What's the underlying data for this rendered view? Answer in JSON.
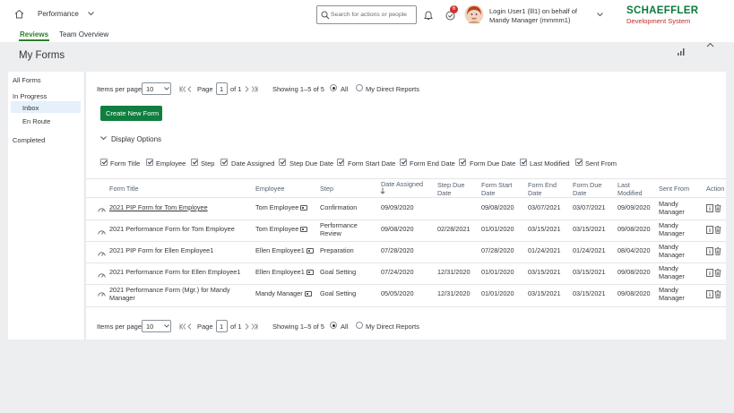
{
  "shell": {
    "module": "Performance",
    "search_placeholder": "Search for actions or people",
    "notif_count": "6",
    "login_line1": "Login User1 (lll1) on behalf of",
    "login_line2": "Mandy Manager (mmmm1)",
    "brand": "SCHAEFFLER",
    "brand_sub": "Development System",
    "colors": {
      "brand": "#0a7a3a",
      "brand_sub": "#c22a2a",
      "accent": "#2b7d2b",
      "link": "#0a5aa6"
    }
  },
  "subnav": {
    "tabs": [
      "Reviews",
      "Team Overview"
    ]
  },
  "page": {
    "title": "My Forms"
  },
  "sidebar": {
    "items": [
      "All Forms",
      "In Progress",
      "Inbox",
      "En Route",
      "Completed"
    ]
  },
  "pager": {
    "items_label": "Items per page",
    "items_value": "10",
    "page_label": "Page",
    "page_value": "1",
    "page_of": "of 1",
    "showing": "Showing 1–5 of 5",
    "filter_all": "All",
    "filter_direct": "My Direct Reports"
  },
  "actions": {
    "create": "Create New Form",
    "display_options": "Display Options"
  },
  "options": [
    "Form Title",
    "Employee",
    "Step",
    "Date Assigned",
    "Step Due Date",
    "Form Start Date",
    "Form End Date",
    "Form Due Date",
    "Last Modified",
    "Sent From"
  ],
  "table": {
    "headers": {
      "title": "Form Title",
      "employee": "Employee",
      "step": "Step",
      "assigned": "Date Assigned",
      "stepdue": "Step Due Date",
      "start": "Form Start Date",
      "end": "Form End Date",
      "due": "Form Due Date",
      "modified": "Last Modified",
      "sent": "Sent From",
      "action": "Action"
    },
    "rows": [
      {
        "title": "2021 PIP Form for Tom Employee",
        "employee": "Tom Employee",
        "step": "Confirmation",
        "assigned": "09/09/2020",
        "stepdue": "",
        "start": "09/08/2020",
        "end": "03/07/2021",
        "due": "03/07/2021",
        "modified": "09/09/2020",
        "sent": "Mandy Manager"
      },
      {
        "title": "2021 Performance Form for Tom Employee",
        "employee": "Tom Employee",
        "step": "Performance Review",
        "assigned": "09/08/2020",
        "stepdue": "02/28/2021",
        "start": "01/01/2020",
        "end": "03/15/2021",
        "due": "03/15/2021",
        "modified": "09/08/2020",
        "sent": "Mandy Manager"
      },
      {
        "title": "2021 PIP Form for Ellen Employee1",
        "employee": "Ellen Employee1",
        "step": "Preparation",
        "assigned": "07/28/2020",
        "stepdue": "",
        "start": "07/28/2020",
        "end": "01/24/2021",
        "due": "01/24/2021",
        "modified": "08/04/2020",
        "sent": "Mandy Manager"
      },
      {
        "title": "2021 Performance Form for Ellen Employee1",
        "employee": "Ellen Employee1",
        "step": "Goal Setting",
        "assigned": "07/24/2020",
        "stepdue": "12/31/2020",
        "start": "01/01/2020",
        "end": "03/15/2021",
        "due": "03/15/2021",
        "modified": "09/08/2020",
        "sent": "Mandy Manager"
      },
      {
        "title": "2021 Performance Form (Mgr.) for Mandy Manager",
        "employee": "Mandy Manager",
        "step": "Goal Setting",
        "assigned": "05/05/2020",
        "stepdue": "12/31/2020",
        "start": "01/01/2020",
        "end": "03/15/2021",
        "due": "03/15/2021",
        "modified": "09/08/2020",
        "sent": "Mandy Manager"
      }
    ]
  }
}
